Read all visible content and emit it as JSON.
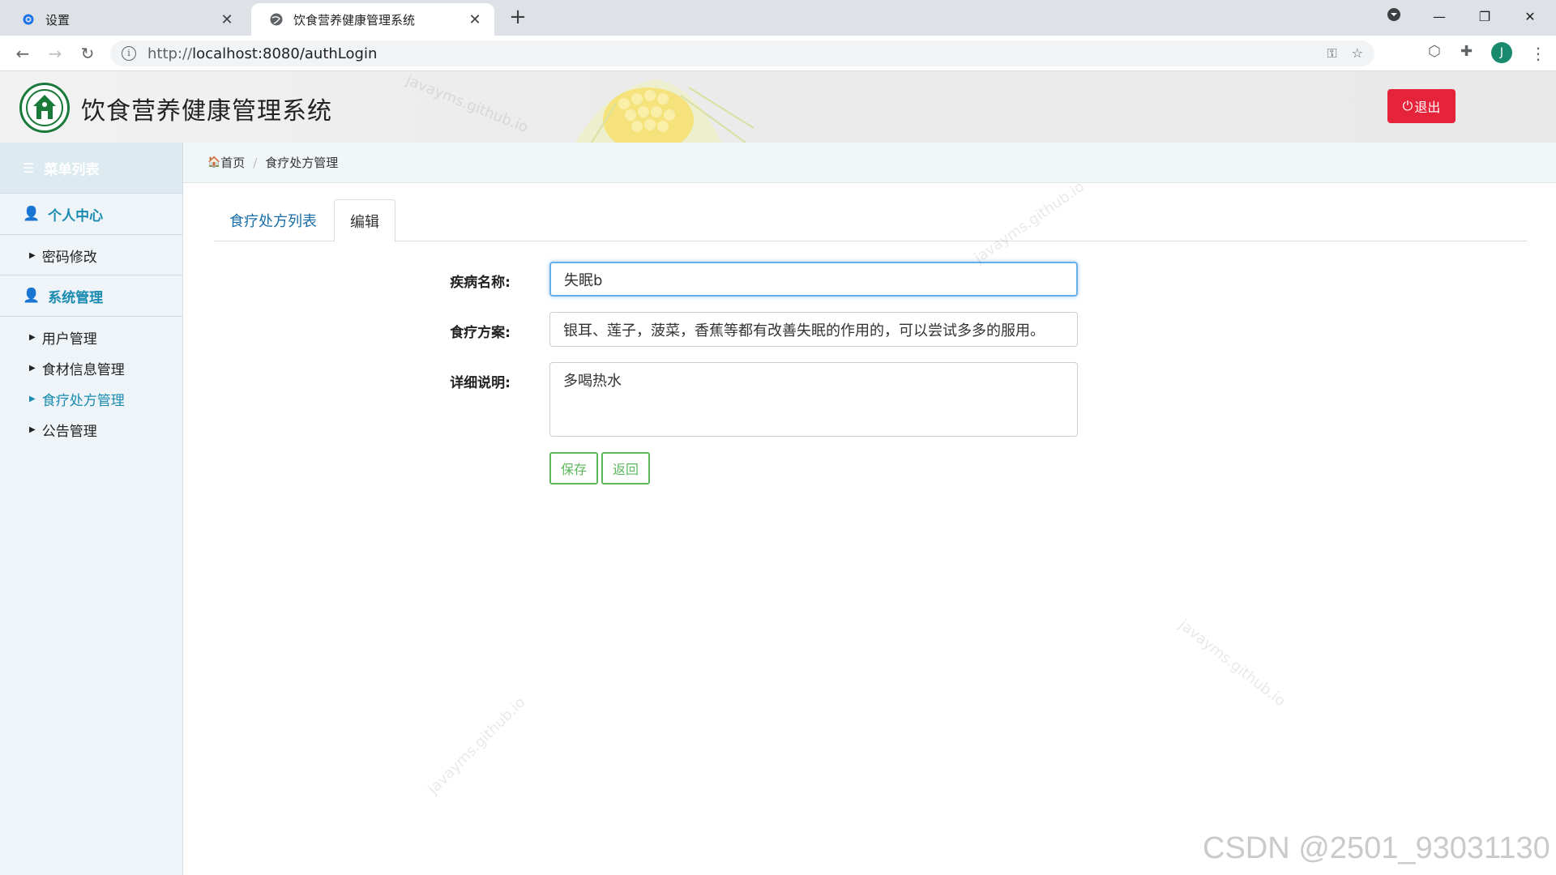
{
  "browser": {
    "tabs": [
      {
        "title": "设置"
      },
      {
        "title": "饮食营养健康管理系统"
      }
    ],
    "url_proto": "http://",
    "url_rest": "localhost:8080/authLogin",
    "avatar_letter": "J"
  },
  "header": {
    "title": "饮食营养健康管理系统",
    "logout_label": "退出"
  },
  "sidebar": {
    "menu_title": "菜单列表",
    "groups": [
      {
        "label": "个人中心",
        "items": [
          "密码修改"
        ]
      },
      {
        "label": "系统管理",
        "items": [
          "用户管理",
          "食材信息管理",
          "食疗处方管理",
          "公告管理"
        ]
      }
    ],
    "active_item": "食疗处方管理"
  },
  "breadcrumb": {
    "home": "首页",
    "current": "食疗处方管理"
  },
  "tabs": {
    "list": "食疗处方列表",
    "edit": "编辑"
  },
  "form": {
    "disease_label": "疾病名称:",
    "disease_value": "失眠b",
    "plan_label": "食疗方案:",
    "plan_value": "银耳、莲子，菠菜，香蕉等都有改善失眠的作用的，可以尝试多多的服用。",
    "detail_label": "详细说明:",
    "detail_value": "多喝热水",
    "save_label": "保存",
    "back_label": "返回"
  },
  "watermarks": {
    "text": "javayms.github.io",
    "csdn": "CSDN @2501_93031130"
  },
  "colors": {
    "accent": "#1a8bb0",
    "logout": "#e5233a",
    "button_green": "#5cb85c"
  }
}
